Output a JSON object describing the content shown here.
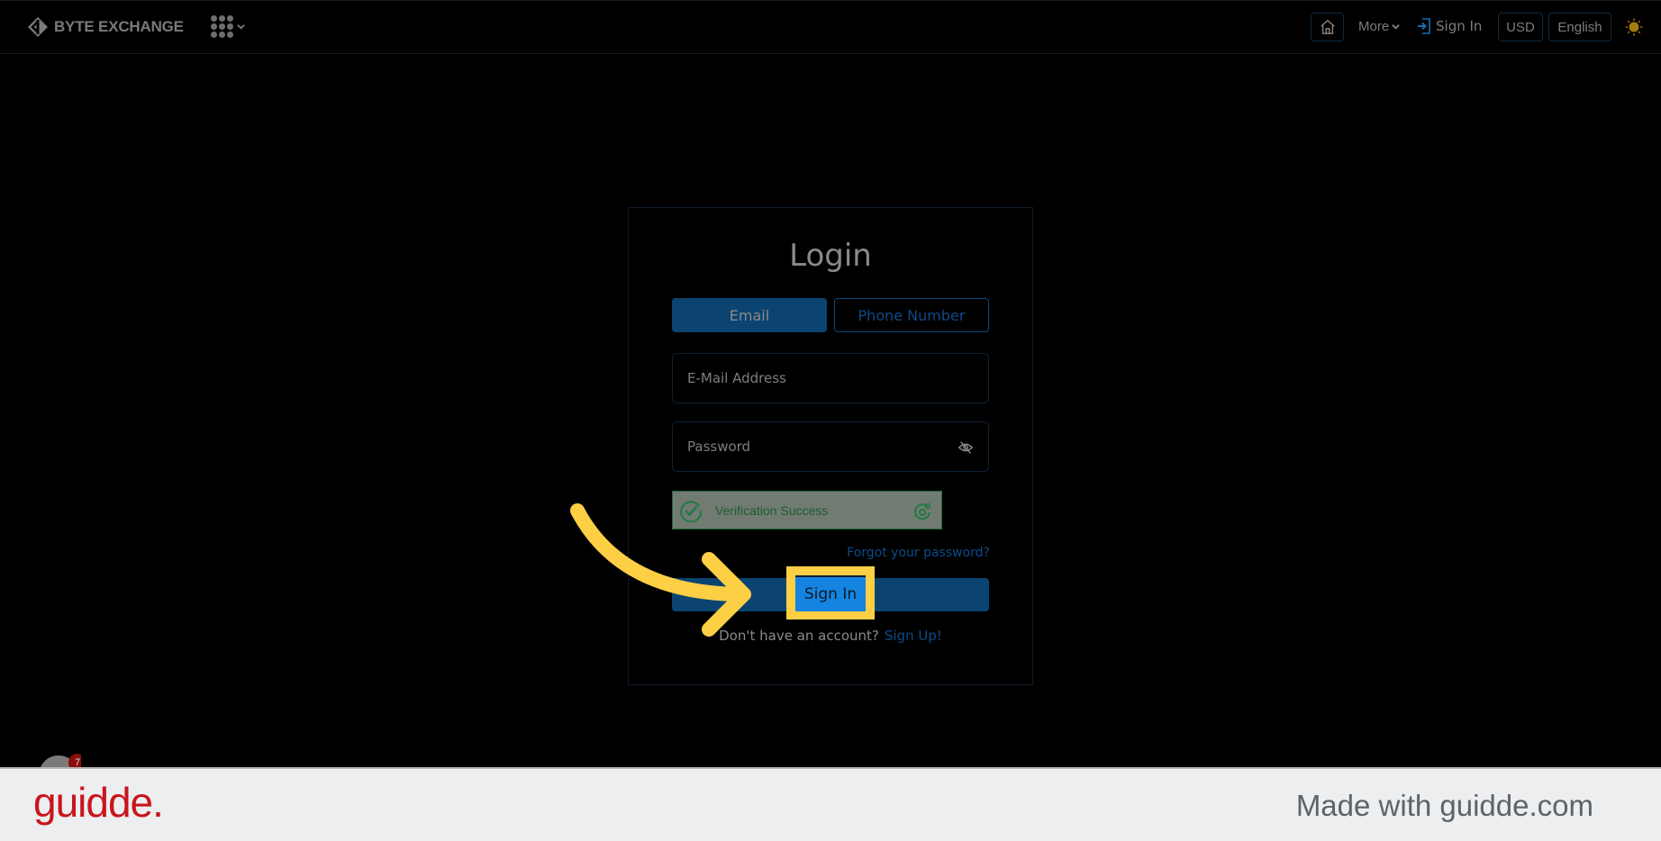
{
  "header": {
    "brand": "BYTE EXCHANGE",
    "icons": {
      "logo": "byte-exchange-logo",
      "apps": "apps-grid-icon",
      "home": "home-icon",
      "signin": "sign-in-icon",
      "theme": "sun-icon"
    },
    "more_label": "More",
    "signin_label": "Sign In",
    "currency": "USD",
    "language": "English"
  },
  "login": {
    "title": "Login",
    "tabs": [
      {
        "label": "Email",
        "active": true
      },
      {
        "label": "Phone Number",
        "active": false
      }
    ],
    "email_placeholder": "E-Mail Address",
    "password_placeholder": "Password",
    "captcha_status": "Verification Success",
    "forgot_label": "Forgot your password?",
    "submit_label": "Sign In",
    "signup_prompt": "Don't have an account?",
    "signup_link": "Sign Up!"
  },
  "overlay": {
    "highlight_target": "Sign In",
    "badge_count": "7",
    "accent_color": "#fdcf45"
  },
  "footer": {
    "brand": "guidde.",
    "made_with": "Made with guidde.com"
  }
}
